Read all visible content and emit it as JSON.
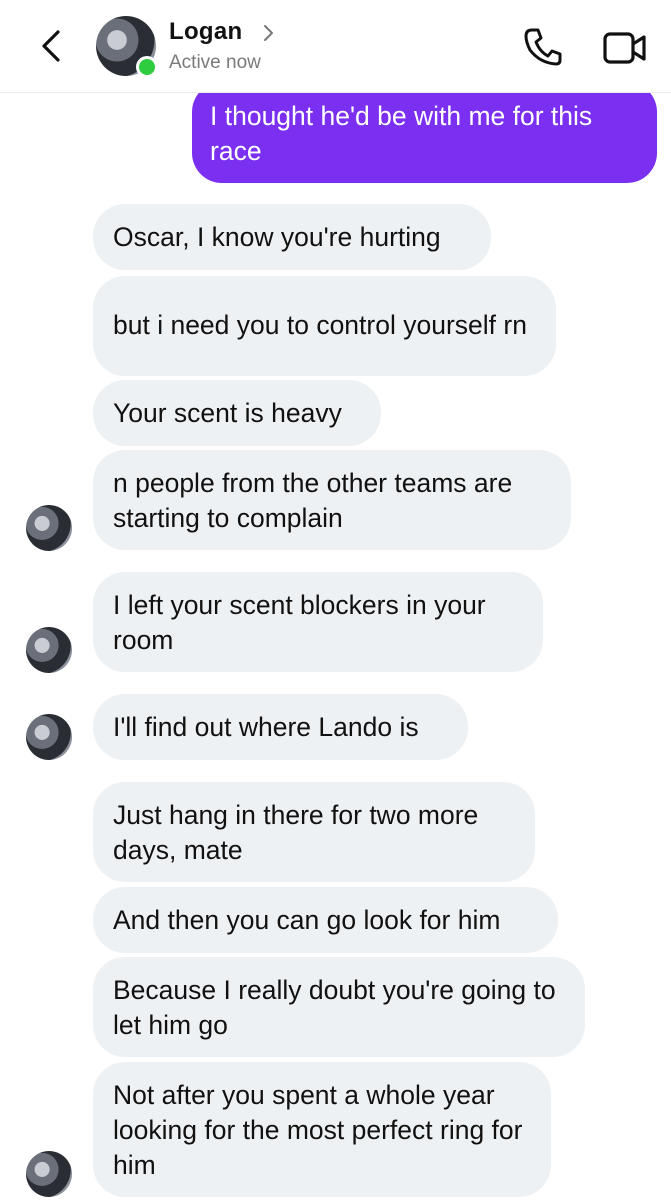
{
  "header": {
    "back_icon": "chevron-left-icon",
    "contact_name": "Logan",
    "contact_status": "Active now",
    "call_icon": "phone-icon",
    "video_icon": "video-camera-icon",
    "online_color": "#2ecc3f"
  },
  "colors": {
    "sent_bubble": "#7b2ff0",
    "received_bubble": "#eef1f3"
  },
  "messages": [
    {
      "from": "me",
      "text": "I thought he'd be with me for this race"
    },
    {
      "from": "logan",
      "text": "Oscar, I know you're hurting"
    },
    {
      "from": "logan",
      "text": "but i need you to control yourself rn"
    },
    {
      "from": "logan",
      "text": "Your scent is heavy"
    },
    {
      "from": "logan",
      "text": "n people from the other teams are starting to complain"
    },
    {
      "from": "logan",
      "text": "I left your scent blockers in your room"
    },
    {
      "from": "logan",
      "text": "I'll find out where Lando is"
    },
    {
      "from": "logan",
      "text": "Just hang in there for two more days, mate"
    },
    {
      "from": "logan",
      "text": "And then you can go look for him"
    },
    {
      "from": "logan",
      "text": "Because I really doubt you're going to let him go"
    },
    {
      "from": "logan",
      "text": "Not after you spent a whole year looking for the most perfect ring for him"
    }
  ]
}
